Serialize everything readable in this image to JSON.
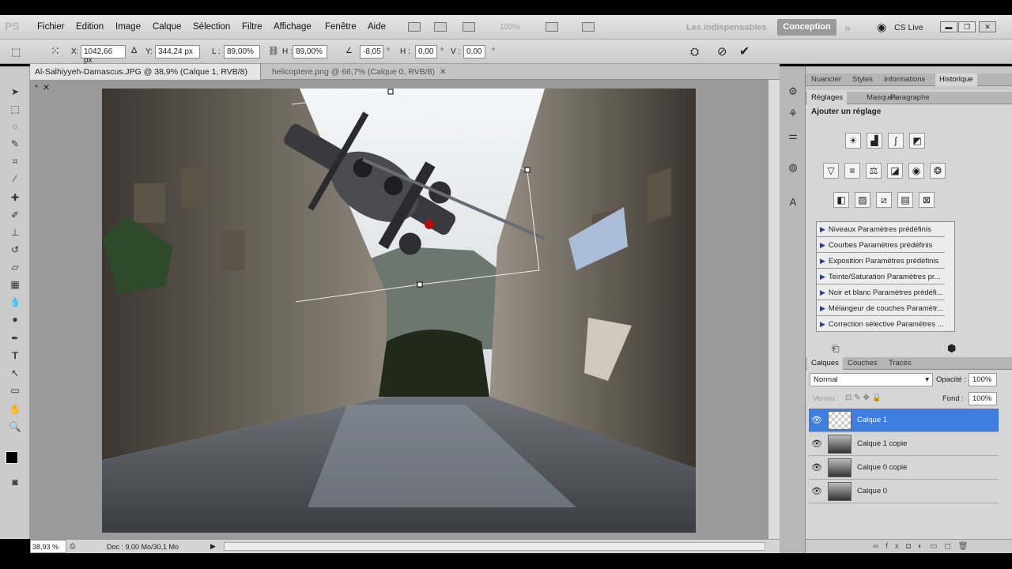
{
  "menubar": {
    "logo": "PS",
    "items": [
      "Fichier",
      "Edition",
      "Image",
      "Calque",
      "Sélection",
      "Filtre",
      "Affichage",
      "Fenêtre",
      "Aide"
    ],
    "zoom": "100%",
    "workspace_inactive": "Les indispensables",
    "workspace_active": "Conception",
    "cs_live": "CS Live"
  },
  "options": {
    "x_label": "X:",
    "x_value": "1042,66 px",
    "y_label": "Y:",
    "y_value": "344,24 px",
    "w_label": "L :",
    "w_value": "89,00%",
    "h_label": "H :",
    "h_value": "89,00%",
    "angle_value": "-8,05",
    "hskew_label": "H :",
    "hskew_value": "0,00",
    "vskew_label": "V :",
    "vskew_value": "0,00",
    "deg": "°"
  },
  "tabs": [
    {
      "label": "Al-Salhiyyeh-Damascus.JPG @ 38,9% (Calque 1, RVB/8) *"
    },
    {
      "label": "helicoptere.png @ 66,7% (Calque 0, RVB/8)"
    }
  ],
  "status": {
    "zoom": "38,93 %",
    "doc": "Doc : 9,00 Mo/30,1 Mo"
  },
  "panel_top": {
    "tabs": [
      "Nuancier",
      "Styles",
      "Informations",
      "Historique"
    ]
  },
  "adjust": {
    "tabs": [
      "Réglages",
      "Masques",
      "Paragraphe"
    ],
    "title": "Ajouter un réglage",
    "presets": [
      "Niveaux Paramètres prédéfinis",
      "Courbes Paramètres prédéfinis",
      "Exposition Paramètres prédéfinis",
      "Teinte/Saturation Paramètres pr...",
      "Noir et blanc Paramètres prédéfi...",
      "Mélangeur de couches Paramètr...",
      "Correction sélective Paramètres ..."
    ]
  },
  "layers": {
    "tabs": [
      "Calques",
      "Couches",
      "Tracés"
    ],
    "blend_mode": "Normal",
    "opacity_label": "Opacité :",
    "opacity": "100%",
    "lock_label": "Verrou :",
    "fill_label": "Fond :",
    "fill": "100%",
    "items": [
      "Calque 1",
      "Calque 1 copie",
      "Calque 0 copie",
      "Calque 0"
    ]
  },
  "colors": {
    "accent": "#3e7ee0",
    "conception": "#9a9a9a"
  }
}
